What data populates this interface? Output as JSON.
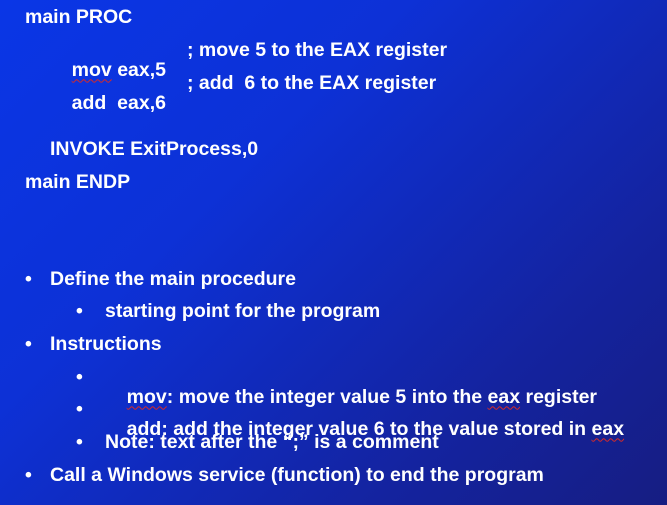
{
  "code": {
    "proc_line": "main PROC",
    "mov_kw": "mov",
    "mov_args": " eax,5",
    "mov_comment": "; move 5 to the EAX register",
    "add_kw": "add",
    "add_args": "  eax,6",
    "add_comment": "; add  6 to the EAX register",
    "invoke_line": "INVOKE ExitProcess,0",
    "endp_line": "main ENDP"
  },
  "bullets": {
    "b1": "Define the main procedure",
    "b1_sub1": "starting point for the program",
    "b2": "Instructions",
    "b2_sub1_kw": "mov",
    "b2_sub1_rest": ": move the integer value 5 into the ",
    "b2_sub1_kw2": "eax",
    "b2_sub1_end": " register",
    "b2_sub2_pre": "add: add the integer value 6 to the value stored in ",
    "b2_sub2_kw": "eax",
    "b2_sub3": "Note: text after the “;” is a comment",
    "b3": "Call a Windows service (function) to end the program",
    "bullet_char": "•"
  },
  "colors": {
    "background_start": "#0a36e6",
    "background_end": "#161d82",
    "text": "#ffffff",
    "spell_underline": "#d32a2a"
  }
}
